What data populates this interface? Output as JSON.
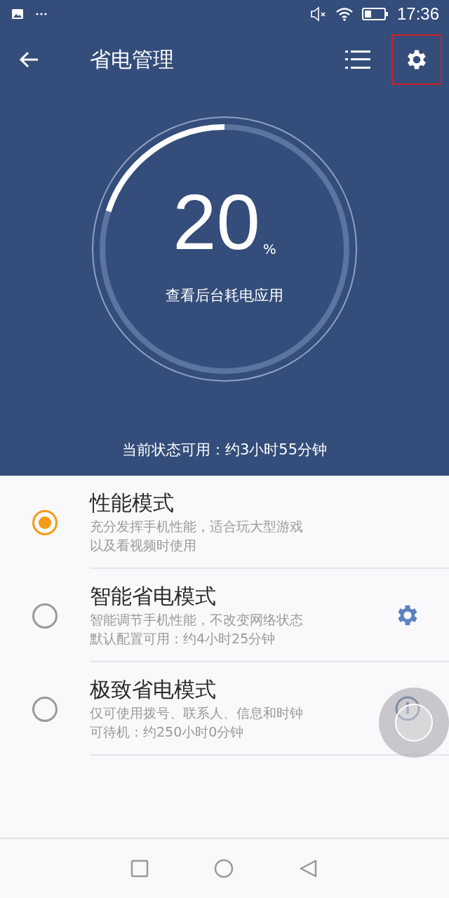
{
  "status_bar": {
    "time": "17:36"
  },
  "toolbar": {
    "title": "省电管理",
    "settings_highlighted": true
  },
  "battery_ring": {
    "value": "20",
    "unit": "%",
    "link": "查看后台耗电应用"
  },
  "available_time": "当前状态可用：约3小时55分钟",
  "modes": [
    {
      "title": "性能模式",
      "lines": [
        "充分发挥手机性能，适合玩大型游戏",
        "以及看视频时使用"
      ],
      "selected": true,
      "kind": "plain"
    },
    {
      "title": "智能省电模式",
      "lines": [
        "智能调节手机性能，不改变网络状态",
        "默认配置可用：约4小时25分钟"
      ],
      "selected": false,
      "kind": "settings"
    },
    {
      "title": "极致省电模式",
      "lines": [
        "仅可使用拨号、联系人、信息和时钟",
        "可待机：约250小时0分钟"
      ],
      "selected": false,
      "kind": "info"
    }
  ]
}
